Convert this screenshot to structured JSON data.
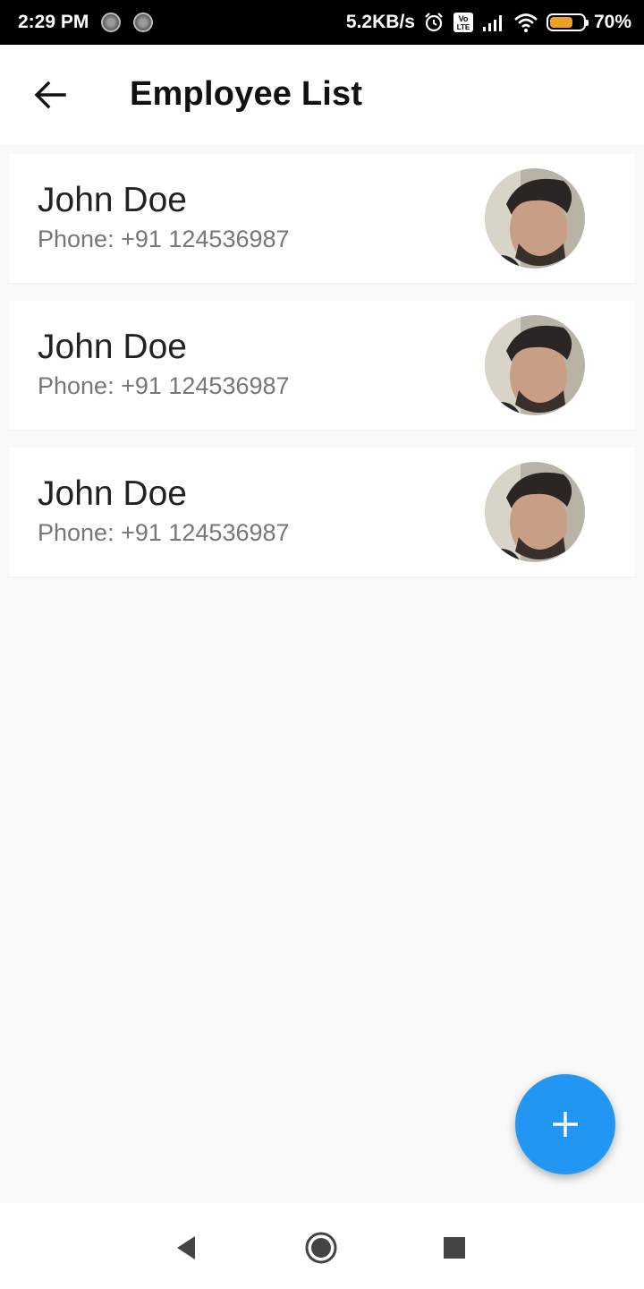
{
  "status_bar": {
    "time": "2:29 PM",
    "network_speed": "5.2KB/s",
    "volte_label_top": "Vo",
    "volte_label_bottom": "LTE",
    "battery_percent": "70%",
    "battery_level": 0.7,
    "battery_color": "#f0a020"
  },
  "app_bar": {
    "title": "Employee List",
    "back_icon": "arrow-back-icon"
  },
  "employees": [
    {
      "name": "John Doe",
      "phone": "Phone: +91 124536987"
    },
    {
      "name": "John Doe",
      "phone": "Phone: +91 124536987"
    },
    {
      "name": "John Doe",
      "phone": "Phone: +91 124536987"
    }
  ],
  "fab": {
    "icon": "plus-icon",
    "color": "#2196f3"
  },
  "nav_bar": {
    "back_icon": "nav-back-icon",
    "home_icon": "nav-home-icon",
    "recents_icon": "nav-recents-icon"
  }
}
